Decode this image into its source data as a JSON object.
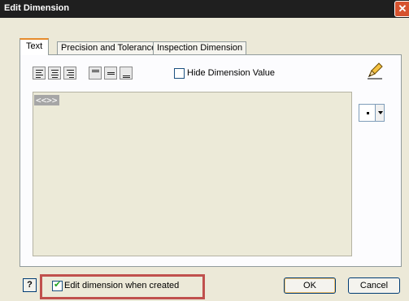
{
  "window": {
    "title": "Edit Dimension",
    "close_glyph": "✕"
  },
  "tabs": [
    {
      "label": "Text",
      "active": true
    },
    {
      "label": "Precision and Tolerance",
      "active": false
    },
    {
      "label": "Inspection Dimension",
      "active": false
    }
  ],
  "toolbar": {
    "justify_buttons": [
      "align-left-icon",
      "align-center-icon",
      "align-right-icon"
    ],
    "vertical_buttons": [
      "align-top-icon",
      "align-middle-icon",
      "align-bottom-icon"
    ],
    "hide_value_label": "Hide Dimension Value",
    "hide_value_checked": false,
    "edit_icon": "pencil-icon"
  },
  "editor": {
    "content": "<<>>"
  },
  "symbol_dropdown": {
    "value": "•"
  },
  "footer": {
    "help_label": "?",
    "edit_on_create_label": "Edit dimension when created",
    "edit_on_create_checked": true,
    "ok_label": "OK",
    "cancel_label": "Cancel"
  },
  "colors": {
    "highlight": "#c0504d",
    "titlebar": "#1f1f1f",
    "close_button": "#d6532f"
  }
}
